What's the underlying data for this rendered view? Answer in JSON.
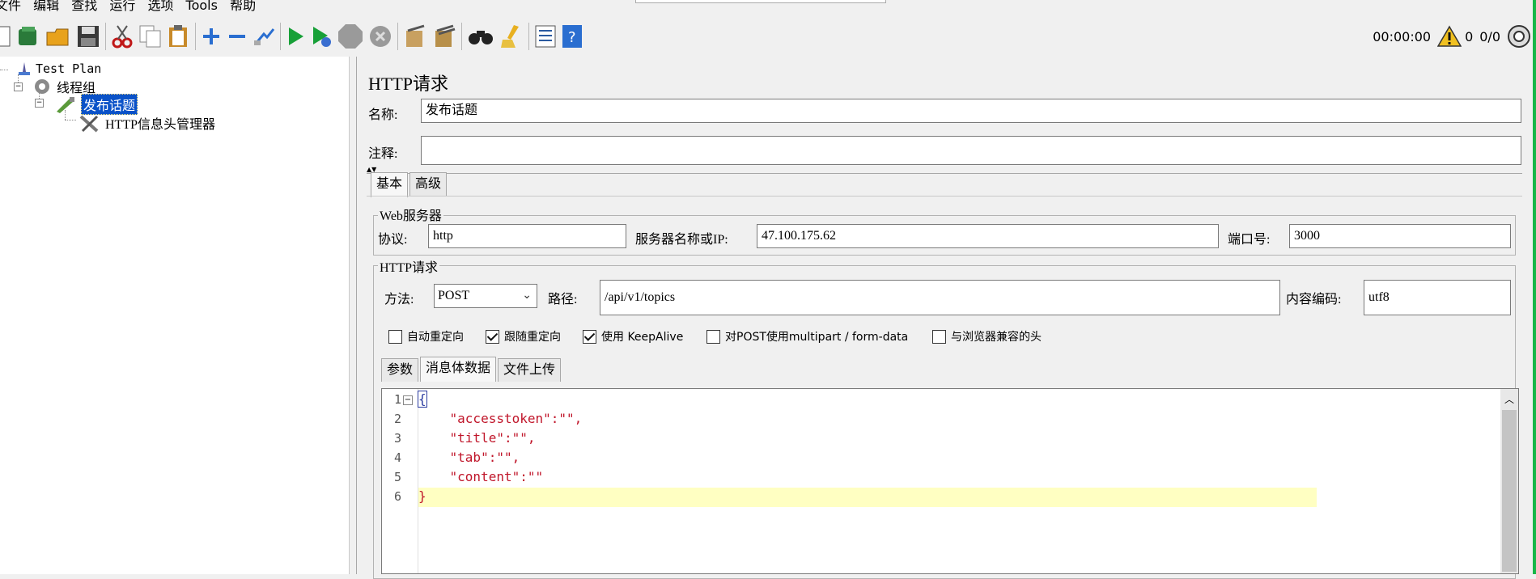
{
  "menu": [
    "文件",
    "编辑",
    "查找",
    "运行",
    "选项",
    "Tools",
    "帮助"
  ],
  "status": {
    "timer": "00:00:00",
    "warnings": "0",
    "threads": "0/0"
  },
  "tree": {
    "root": "Test Plan",
    "thread_group": "线程组",
    "sampler": "发布话题",
    "header_manager": "HTTP信息头管理器"
  },
  "panel": {
    "title": "HTTP请求",
    "name_label": "名称:",
    "name_value": "发布话题",
    "comment_label": "注释:",
    "comment_value": "",
    "tabs": [
      "基本",
      "高级"
    ],
    "web_server": {
      "title": "Web服务器",
      "protocol_label": "协议:",
      "protocol": "http",
      "server_label": "服务器名称或IP:",
      "server": "47.100.175.62",
      "port_label": "端口号:",
      "port": "3000"
    },
    "http_request": {
      "title": "HTTP请求",
      "method_label": "方法:",
      "method": "POST",
      "path_label": "路径:",
      "path": "/api/v1/topics",
      "encoding_label": "内容编码:",
      "encoding": "utf8"
    },
    "options": [
      {
        "label": "自动重定向",
        "checked": false
      },
      {
        "label": "跟随重定向",
        "checked": true
      },
      {
        "label": "使用 KeepAlive",
        "checked": true
      },
      {
        "label": "对POST使用multipart / form-data",
        "checked": false
      },
      {
        "label": "与浏览器兼容的头",
        "checked": false
      }
    ],
    "body_tabs": [
      "参数",
      "消息体数据",
      "文件上传"
    ],
    "body_lines": [
      "{",
      "    \"accesstoken\":\"\",",
      "    \"title\":\"\",",
      "    \"tab\":\"\",",
      "    \"content\":\"\"",
      "}"
    ],
    "line_numbers": [
      "1",
      "2",
      "3",
      "4",
      "5",
      "6"
    ]
  }
}
